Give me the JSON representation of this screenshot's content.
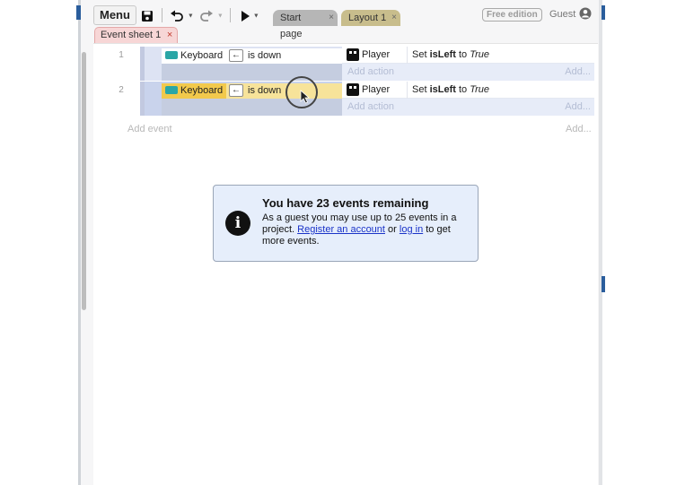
{
  "toolbar": {
    "menu_label": "Menu",
    "save_icon": "save-icon",
    "undo_icon": "undo-icon",
    "redo_icon": "redo-icon",
    "play_icon": "play-icon",
    "tabs": [
      {
        "label": "Start page",
        "close": "×"
      },
      {
        "label": "Layout 1",
        "close": "×"
      }
    ],
    "edition_badge": "Free edition",
    "guest_label": "Guest",
    "user_icon": "user-circle-icon"
  },
  "event_sheet_tab": {
    "label": "Event sheet 1",
    "close": "×"
  },
  "events": [
    {
      "number": "1",
      "object": "Keyboard",
      "key_icon": "←",
      "condition": "is down",
      "action_object": "Player",
      "action_prefix": "Set",
      "action_var": "isLeft",
      "action_mid": "to",
      "action_value": "True",
      "add_action": "Add action",
      "add_more": "Add..."
    },
    {
      "number": "2",
      "object": "Keyboard",
      "key_icon": "←",
      "condition": "is down",
      "action_object": "Player",
      "action_prefix": "Set",
      "action_var": "isLeft",
      "action_mid": "to",
      "action_value": "True",
      "add_action": "Add action",
      "add_more": "Add..."
    }
  ],
  "add_event": {
    "label": "Add event",
    "more": "Add..."
  },
  "notice": {
    "title": "You have 23 events remaining",
    "text_1": "As a guest you may use up to 25 events in a project. ",
    "link_register": "Register an account",
    "text_2": " or ",
    "link_login": "log in",
    "text_3": " to get more events.",
    "icon": "info-icon"
  },
  "colors": {
    "condition_bg": "#dde3f3",
    "selected_highlight": "#f7e39a",
    "tab_layout": "#c8bd8c",
    "sheet_tab": "#f7d6d6",
    "notice_bg": "#e6eefb",
    "link": "#1a33c8"
  }
}
